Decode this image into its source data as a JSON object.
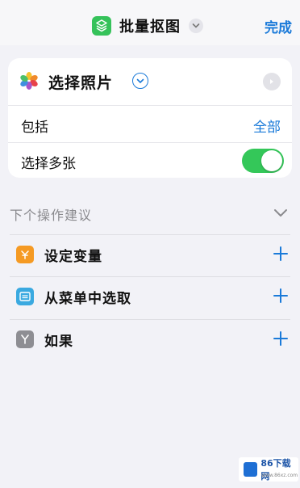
{
  "navbar": {
    "title": "批量抠图",
    "app_icon": "shortcut-layers-icon",
    "done_label": "完成"
  },
  "action": {
    "title": "选择照片",
    "icon": "photos-icon",
    "include_label": "包括",
    "include_value": "全部",
    "multi_label": "选择多张",
    "multi_enabled": true
  },
  "suggestions": {
    "header": "下个操作建议",
    "items": [
      {
        "label": "设定变量",
        "icon": "variable-icon",
        "color": "#f59a23"
      },
      {
        "label": "从菜单中选取",
        "icon": "menu-icon",
        "color": "#3aa9e0"
      },
      {
        "label": "如果",
        "icon": "branch-icon",
        "color": "#8e8e93"
      }
    ]
  },
  "watermark": {
    "text": "86下载网",
    "sub": "www.86xz.com"
  },
  "colors": {
    "accent": "#1a7ad9",
    "toggle_on": "#34c759",
    "app_icon_bg": "#35c25a"
  }
}
